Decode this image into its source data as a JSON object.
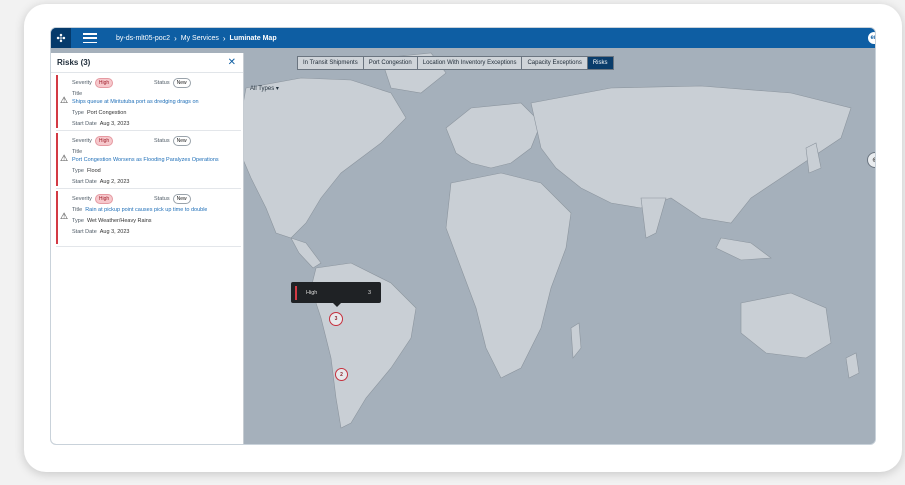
{
  "header": {
    "breadcrumbs": [
      "by-ds-mlt05-poc2",
      "My Services",
      "Luminate Map"
    ],
    "avatar_initials": "en"
  },
  "tabs": [
    {
      "label": "In Transit Shipments",
      "active": false
    },
    {
      "label": "Port Congestion",
      "active": false
    },
    {
      "label": "Location With Inventory Exceptions",
      "active": false
    },
    {
      "label": "Capacity Exceptions",
      "active": false
    },
    {
      "label": "Risks",
      "active": true
    }
  ],
  "filter": {
    "type_label": "All Types"
  },
  "panel": {
    "title": "Risks (3)",
    "labels": {
      "severity": "Severity",
      "status": "Status",
      "title": "Title",
      "type": "Type",
      "start_date": "Start Date"
    },
    "items": [
      {
        "severity": "High",
        "status": "New",
        "title": "Ships queue at Miritutuba port as dredging drags on",
        "type": "Port Congestion",
        "start_date": "Aug 3, 2023"
      },
      {
        "severity": "High",
        "status": "New",
        "title": "Port Congestion Worsens as Flooding Paralyzes Operations",
        "type": "Flood",
        "start_date": "Aug 2, 2023"
      },
      {
        "severity": "High",
        "status": "New",
        "title": "Rain at pickup point causes pick up time to double",
        "type": "Wet Weather/Heavy Rains",
        "start_date": "Aug 3, 2023"
      }
    ]
  },
  "map": {
    "tooltip": {
      "label": "High",
      "count": "3"
    },
    "clusters": [
      {
        "count": "3"
      },
      {
        "count": "2"
      }
    ]
  },
  "colors": {
    "brand": "#0e5ea3",
    "risk_high": "#d33a44",
    "active_tab": "#0a3d6b"
  }
}
